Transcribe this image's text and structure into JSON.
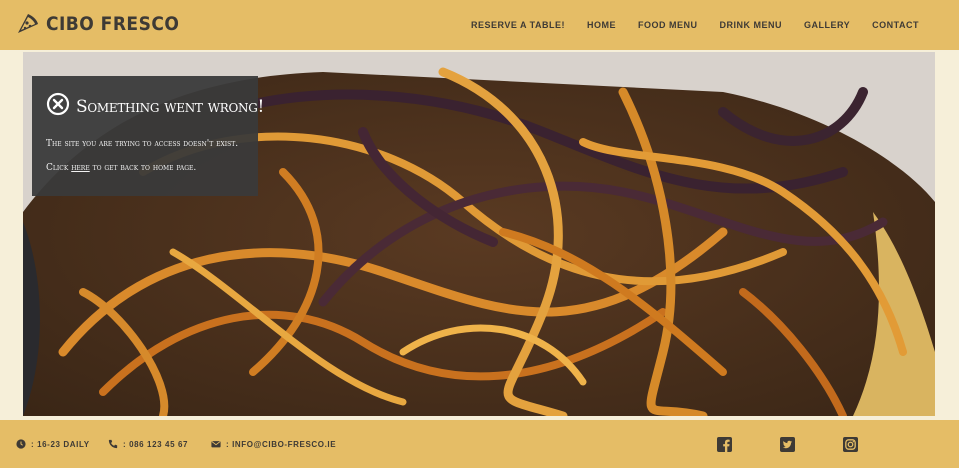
{
  "brand": {
    "name": "Cibo Fresco",
    "icon": "pizza-slice-icon"
  },
  "nav": {
    "items": [
      {
        "label": "Reserve a table!"
      },
      {
        "label": "Home"
      },
      {
        "label": "Food Menu"
      },
      {
        "label": "Drink Menu"
      },
      {
        "label": "Gallery"
      },
      {
        "label": "Contact"
      }
    ]
  },
  "error": {
    "icon": "circle-x-icon",
    "title": "Something went wrong!",
    "message": "The site you are trying to access doesn't exist.",
    "link_prefix": "Click ",
    "link_text": "here",
    "link_suffix": " to get back to home page."
  },
  "footer": {
    "hours": {
      "icon": "clock-icon",
      "text": ": 16-23 Daily"
    },
    "phone": {
      "icon": "phone-icon",
      "text": ": 086 123 45 67"
    },
    "email": {
      "icon": "envelope-icon",
      "text": ": info@cibo-fresco.ie"
    },
    "social": [
      "facebook-icon",
      "twitter-icon",
      "instagram-icon"
    ]
  },
  "colors": {
    "header_bg": "#e5bd66",
    "page_bg": "#f6efd9",
    "text_dark": "#3e3a35",
    "error_bg": "#3a3a3a"
  }
}
